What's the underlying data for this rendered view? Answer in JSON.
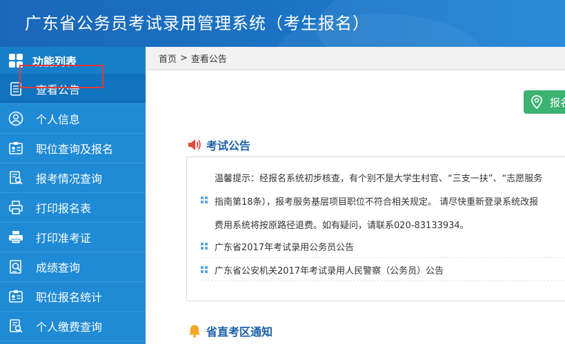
{
  "header": {
    "title": "广东省公务员考试录用管理系统（考生报名）"
  },
  "sidebar": {
    "title": "功能列表",
    "items": [
      {
        "label": "查看公告",
        "icon": "document-list-icon"
      },
      {
        "label": "个人信息",
        "icon": "user-circle-icon"
      },
      {
        "label": "职位查询及报名",
        "icon": "id-card-icon"
      },
      {
        "label": "报考情况查询",
        "icon": "search-document-icon"
      },
      {
        "label": "打印报名表",
        "icon": "printer-icon"
      },
      {
        "label": "打印准考证",
        "icon": "printer-filled-icon"
      },
      {
        "label": "成绩查询",
        "icon": "score-search-icon"
      },
      {
        "label": "职位报名统计",
        "icon": "id-card-icon"
      },
      {
        "label": "个人缴费查询",
        "icon": "payment-search-icon"
      }
    ]
  },
  "breadcrumb": {
    "home": "首页",
    "separator": ">",
    "current": "查看公告"
  },
  "report_button": {
    "label": "报名"
  },
  "exam_notice": {
    "title": "考试公告",
    "tip_lines": [
      "温馨提示：经报名系统初步核查，有个别不是大学生村官、“三支一扶”、“志愿服务",
      "指南第18条），报考服务基层项目职位不符合相关规定。 请尽快重新登录系统改报",
      "费用系统将按原路径退费。如有疑问，请联系020-83133934。"
    ],
    "items": [
      "广东省2017年考试录用公务员公告",
      "广东省公安机关2017年考试录用人民警察（公务员）公告"
    ]
  },
  "exam_area_notice": {
    "title": "省直考区通知"
  },
  "colors": {
    "header_blue": "#1b74c6",
    "sidebar_blue": "#1f8ad5",
    "accent_green": "#3cb371",
    "title_blue": "#1a5fa8"
  }
}
